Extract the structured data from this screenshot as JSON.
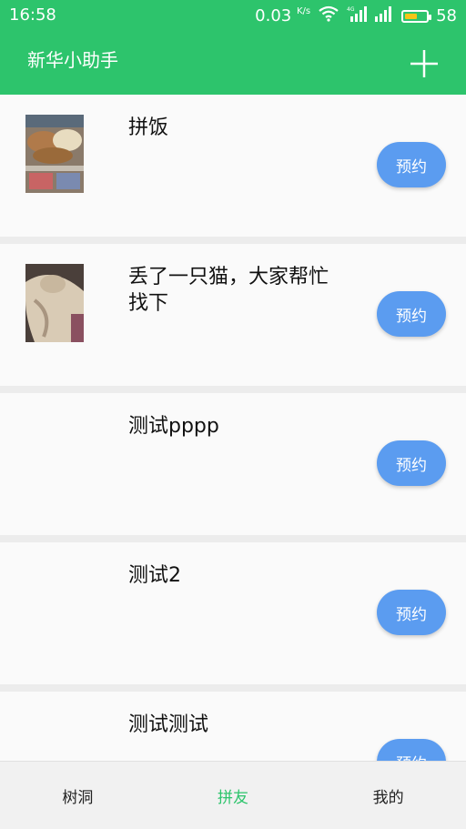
{
  "status_bar": {
    "time": "16:58",
    "speed_value": "0.03",
    "speed_unit": "K/s",
    "battery": "58",
    "battery_level_percent": 58
  },
  "app_bar": {
    "title": "新华小助手",
    "add_icon": "plus-icon"
  },
  "posts": [
    {
      "title": "拼饭",
      "has_image": true,
      "image_subject": "food",
      "button": "预约"
    },
    {
      "title": "丢了一只猫，大家帮忙找下",
      "has_image": true,
      "image_subject": "cat",
      "button": "预约"
    },
    {
      "title": "测试pppp",
      "has_image": false,
      "button": "预约"
    },
    {
      "title": "测试2",
      "has_image": false,
      "button": "预约"
    },
    {
      "title": "测试测试",
      "has_image": false,
      "button": "预约"
    }
  ],
  "tabs": [
    {
      "label": "树洞",
      "active": false
    },
    {
      "label": "拼友",
      "active": true
    },
    {
      "label": "我的",
      "active": false
    }
  ],
  "colors": {
    "primary": "#2dc46c",
    "button": "#5b9cf0",
    "card": "#fafafa",
    "divider": "#ececec"
  }
}
